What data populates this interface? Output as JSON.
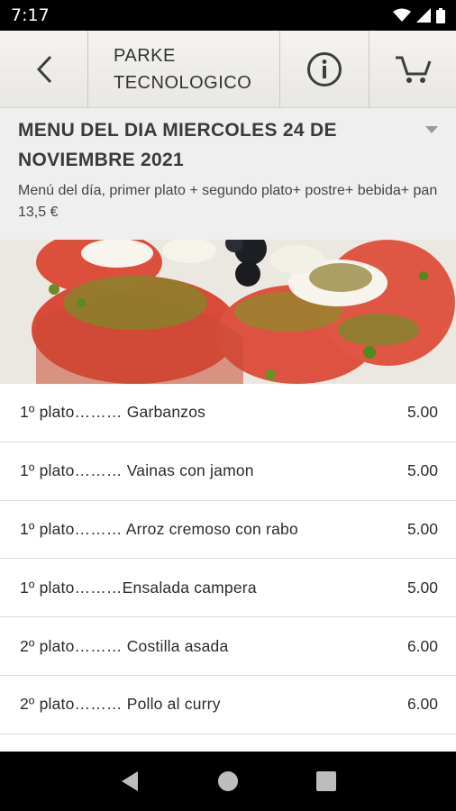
{
  "status": {
    "time": "7:17",
    "icons": [
      "wifi-icon",
      "signal-icon",
      "battery-icon"
    ]
  },
  "header": {
    "store_name_line1": "PARKE",
    "store_name_line2": "TECNOLOGICO",
    "icons": [
      "back-arrow-icon",
      "info-icon",
      "cart-icon"
    ]
  },
  "menu": {
    "title": "MENU DEL DIA MIERCOLES 24 DE NOVIEMBRE 2021",
    "description": "Menú del día, primer plato + segundo plato+ postre+ bebida+ pan 13,5 €"
  },
  "dishes": [
    {
      "name": "1º plato……… Garbanzos",
      "price": "5.00"
    },
    {
      "name": "1º plato……… Vainas con jamon",
      "price": "5.00"
    },
    {
      "name": "1º plato……… Arroz cremoso con rabo",
      "price": "5.00"
    },
    {
      "name": "1º plato………Ensalada campera",
      "price": "5.00"
    },
    {
      "name": "2º plato……… Costilla asada",
      "price": "6.00"
    },
    {
      "name": "2º plato……… Pollo al curry",
      "price": "6.00"
    }
  ],
  "colors": {
    "status_bar": "#000000",
    "header_bg": "#eeece9",
    "menu_bg": "#efefef",
    "text": "#2b2b2b"
  }
}
